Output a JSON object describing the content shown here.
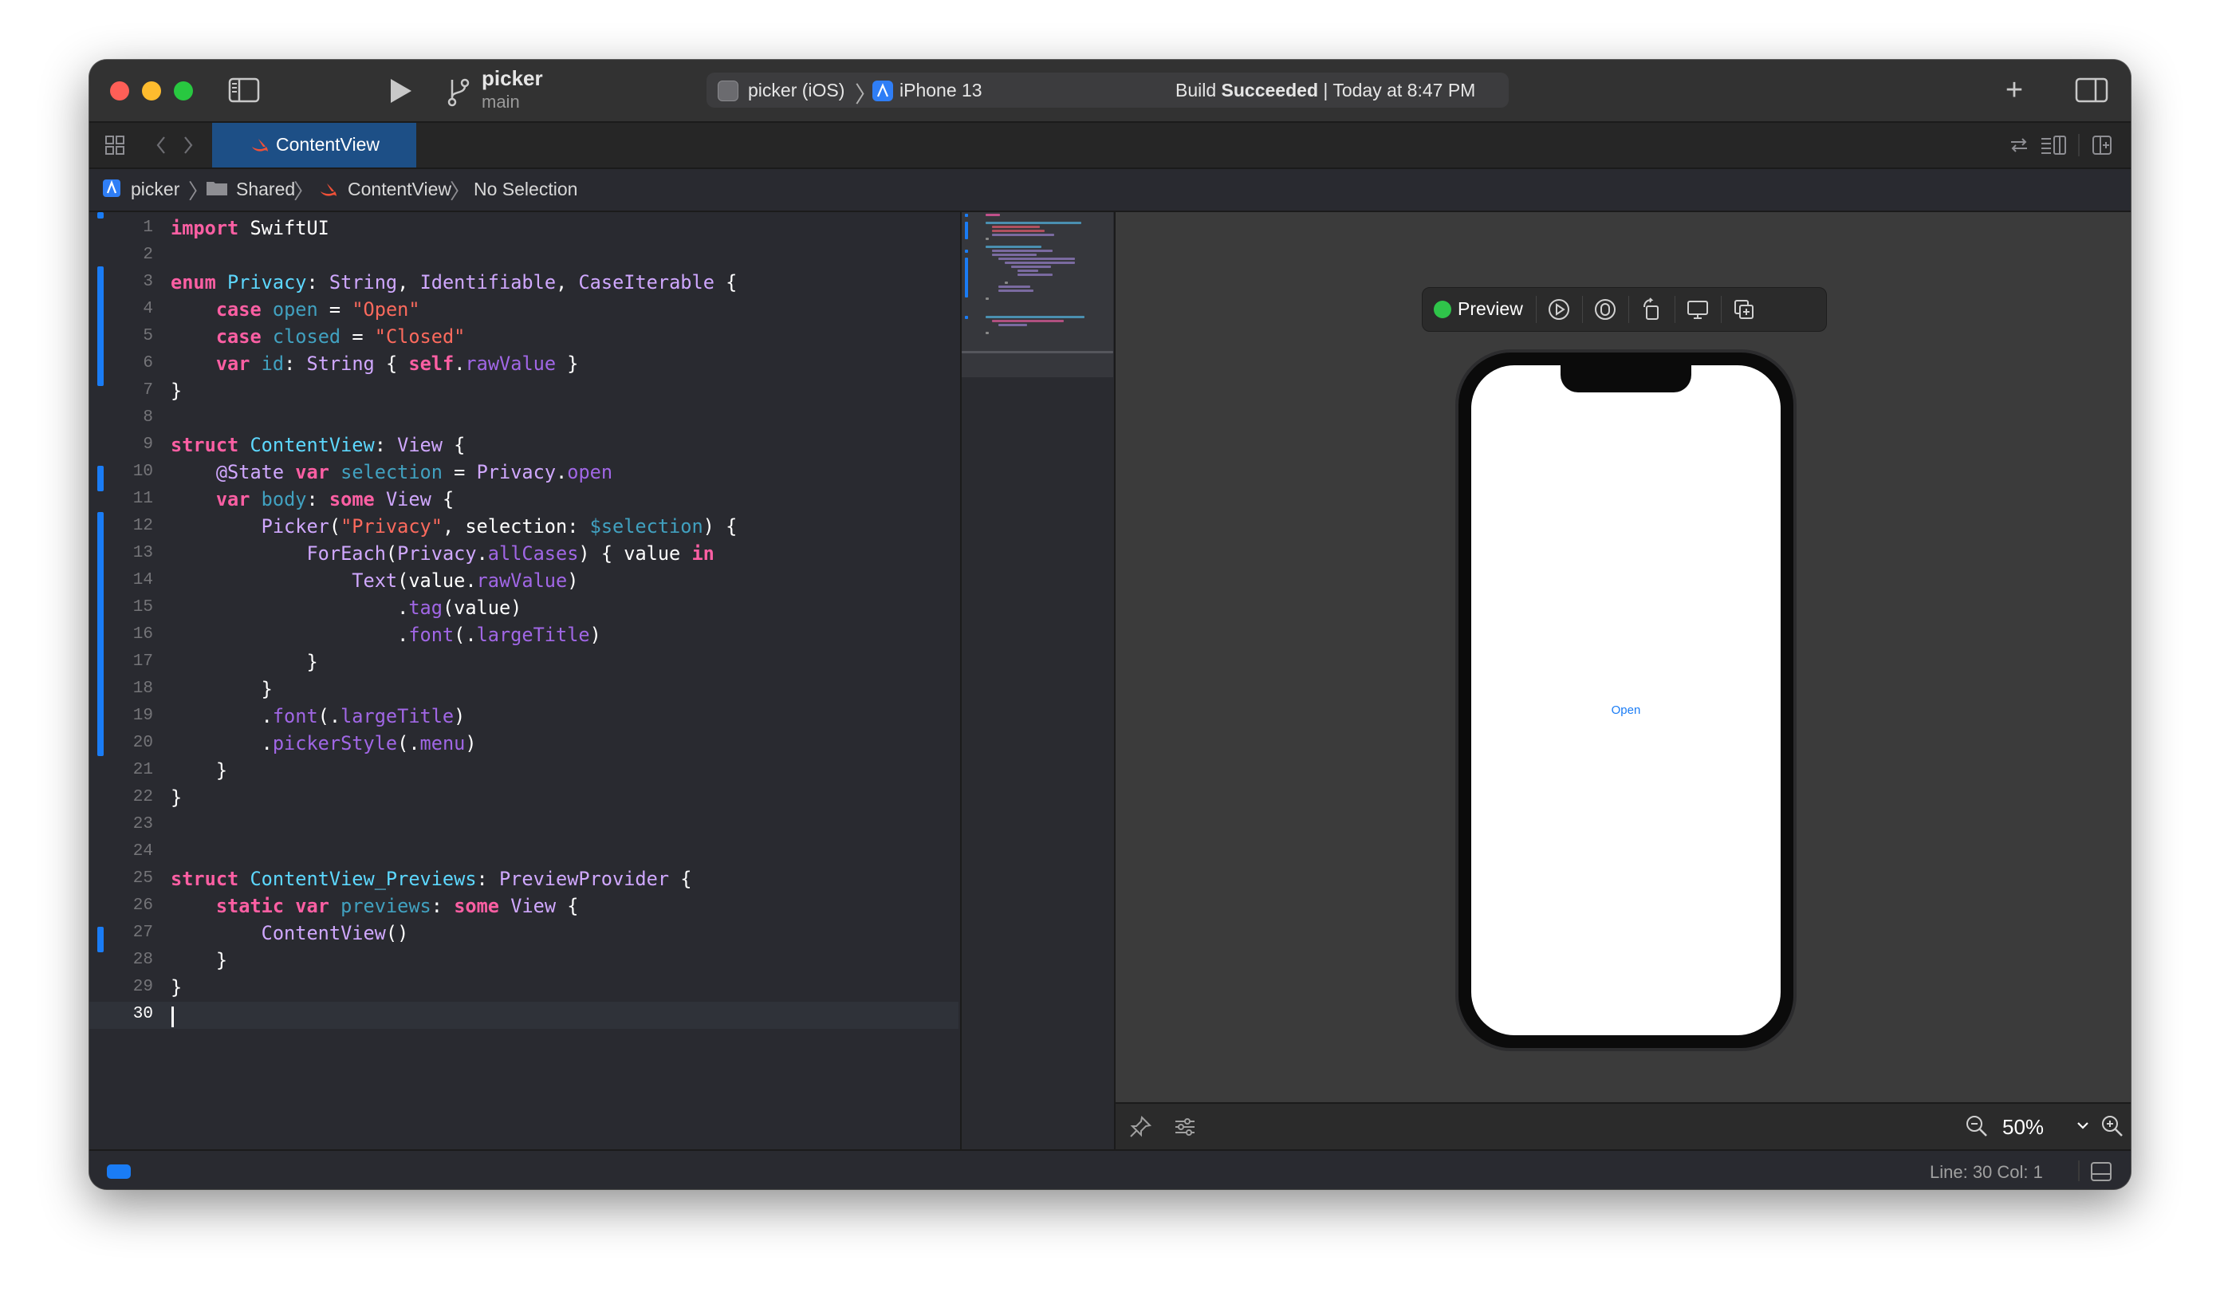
{
  "toolbar": {
    "project_name": "picker",
    "branch": "main",
    "scheme": "picker (iOS)",
    "device": "iPhone 13",
    "status_prefix": "Build",
    "status_bold": "Succeeded",
    "status_suffix": " | Today at 8:47 PM"
  },
  "tab": {
    "label": "ContentView"
  },
  "jumpbar": {
    "items": [
      "picker",
      "Shared",
      "ContentView",
      "No Selection"
    ]
  },
  "editor": {
    "line_numbers": [
      "1",
      "2",
      "3",
      "4",
      "5",
      "6",
      "7",
      "8",
      "9",
      "10",
      "11",
      "12",
      "13",
      "14",
      "15",
      "16",
      "17",
      "18",
      "19",
      "20",
      "21",
      "22",
      "23",
      "24",
      "25",
      "26",
      "27",
      "28",
      "29",
      "30"
    ],
    "current_line": "30"
  },
  "canvas": {
    "preview_label": "Preview",
    "picker_value": "Open",
    "zoom": "50%"
  },
  "statusbar": {
    "line_col": "Line: 30  Col: 1"
  },
  "colors": {
    "keyword": "#fc5fa3",
    "type": "#5dd8ff",
    "other_type": "#d0a8ff",
    "string": "#fc6a5d",
    "property": "#a167e6",
    "declaration": "#41a1c0",
    "accent": "#1a7cf5"
  }
}
